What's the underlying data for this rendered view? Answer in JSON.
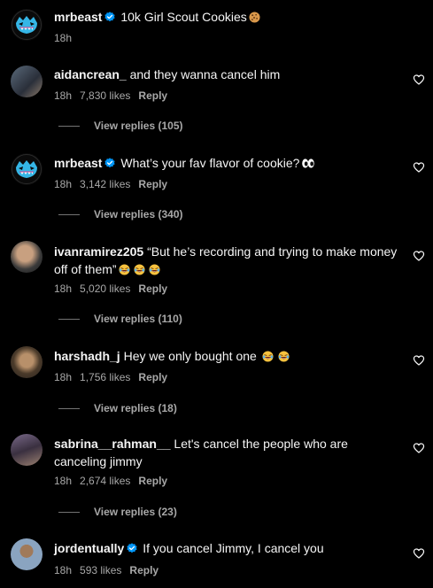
{
  "caption": {
    "username": "mrbeast",
    "verified": true,
    "text": "10k Girl Scout Cookies",
    "emoji": "cookie",
    "time": "18h"
  },
  "comments": [
    {
      "username": "aidancrean_",
      "verified": false,
      "text": "and they wanna cancel him",
      "time": "18h",
      "likes": "7,830 likes",
      "reply": "Reply",
      "view_replies": "View replies (105)"
    },
    {
      "username": "mrbeast",
      "verified": true,
      "text": "What’s your fav flavor of cookie?",
      "emoji": "eyes",
      "time": "18h",
      "likes": "3,142 likes",
      "reply": "Reply",
      "view_replies": "View replies (340)"
    },
    {
      "username": "ivanramirez205",
      "verified": false,
      "text": "“But he’s recording and trying to make money off of them”",
      "emoji": "laughing x3",
      "time": "18h",
      "likes": "5,020 likes",
      "reply": "Reply",
      "view_replies": "View replies (110)"
    },
    {
      "username": "harshadh_j",
      "verified": false,
      "text": "Hey we only bought one",
      "emoji": "laughing x2",
      "time": "18h",
      "likes": "1,756 likes",
      "reply": "Reply",
      "view_replies": "View replies (18)"
    },
    {
      "username": "sabrina__rahman__",
      "verified": false,
      "text": "Let's cancel the people who are canceling jimmy",
      "time": "18h",
      "likes": "2,674 likes",
      "reply": "Reply",
      "view_replies": "View replies (23)"
    },
    {
      "username": "jordentually",
      "verified": true,
      "text": "If you cancel Jimmy, I cancel you",
      "time": "18h",
      "likes": "593 likes",
      "reply": "Reply"
    }
  ],
  "colors": {
    "background": "#000000",
    "text": "#f5f5f5",
    "muted": "#a8a8a8",
    "verified": "#0095f6"
  }
}
